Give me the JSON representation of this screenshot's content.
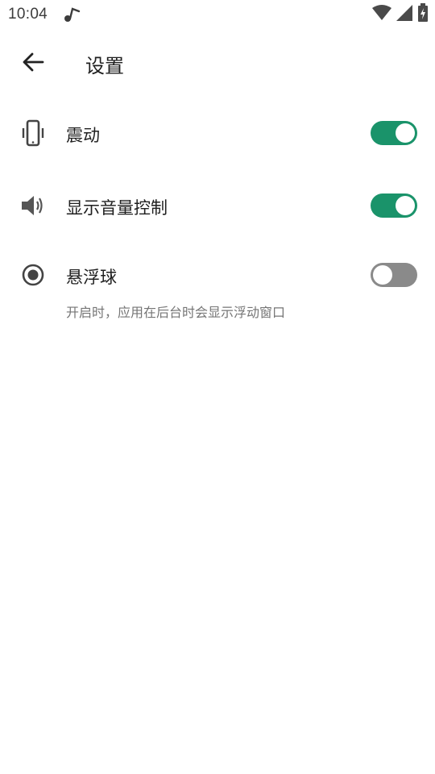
{
  "status_bar": {
    "time": "10:04",
    "icons": [
      "music-note-icon",
      "wifi-icon",
      "signal-icon",
      "battery-charging-icon"
    ]
  },
  "app_bar": {
    "back_icon": "arrow-left-icon",
    "title": "设置"
  },
  "settings": {
    "items": [
      {
        "label": "震动",
        "icon": "phone-vibrate-icon",
        "enabled": true
      },
      {
        "label": "显示音量控制",
        "icon": "volume-icon",
        "enabled": true
      },
      {
        "label": "悬浮球",
        "icon": "radio-button-icon",
        "enabled": false,
        "subtitle": "开启时，应用在后台时会显示浮动窗口"
      }
    ]
  },
  "colors": {
    "toggle_on": "#1a936a",
    "toggle_off": "#8a8a8a",
    "primary_text": "#1f1f1f",
    "secondary_text": "#757575"
  }
}
